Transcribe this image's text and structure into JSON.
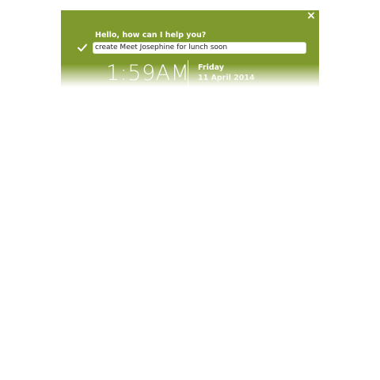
{
  "assistant": {
    "close_label": "×",
    "prompt": "Hello, how can I help you?",
    "input_value": "create Meet Josephine for lunch soon",
    "icons": {
      "check": "check-icon",
      "close": "close-icon"
    }
  },
  "clock": {
    "time": "1:59AM",
    "day": "Friday",
    "date": "11 April 2014"
  },
  "colors": {
    "panel": "#7f9a2c",
    "text": "#ffffff"
  }
}
